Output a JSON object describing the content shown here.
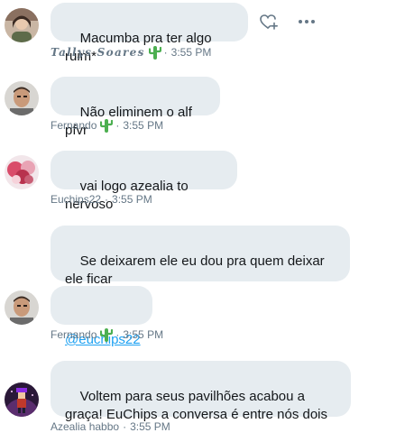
{
  "messages": [
    {
      "text": "Macumba pra ter algo ruim*",
      "author": "Tallys Soares",
      "emoji": "cactus",
      "separator": "·",
      "time": "3:55 PM",
      "actions": [
        "like-heart-plus-icon",
        "more-options-icon"
      ]
    },
    {
      "text": "Não eliminem o alf pfvr",
      "author": "Fernando",
      "emoji": "cactus",
      "separator": "·",
      "time": "3:55 PM"
    },
    {
      "text": "vai logo azealia to nervoso",
      "author": "Euchips22",
      "separator": "·",
      "time": "3:55 PM"
    },
    {
      "text": "Se deixarem ele eu dou pra quem deixar ele ficar"
    },
    {
      "mention": "@euchips22",
      "author": "Fernando",
      "emoji": "cactus",
      "separator": "·",
      "time": "3:55 PM"
    },
    {
      "text": "Voltem para seus pavilhões acabou a graça! EuChips a conversa é entre nós dois",
      "author": "Azealia habbo",
      "separator": "·",
      "time": "3:55 PM"
    }
  ],
  "colors": {
    "bubble": "#e6ecf0",
    "meta_text": "#657786",
    "link": "#1da1f2",
    "icon": "#657786",
    "cactus": "#4caf50"
  }
}
